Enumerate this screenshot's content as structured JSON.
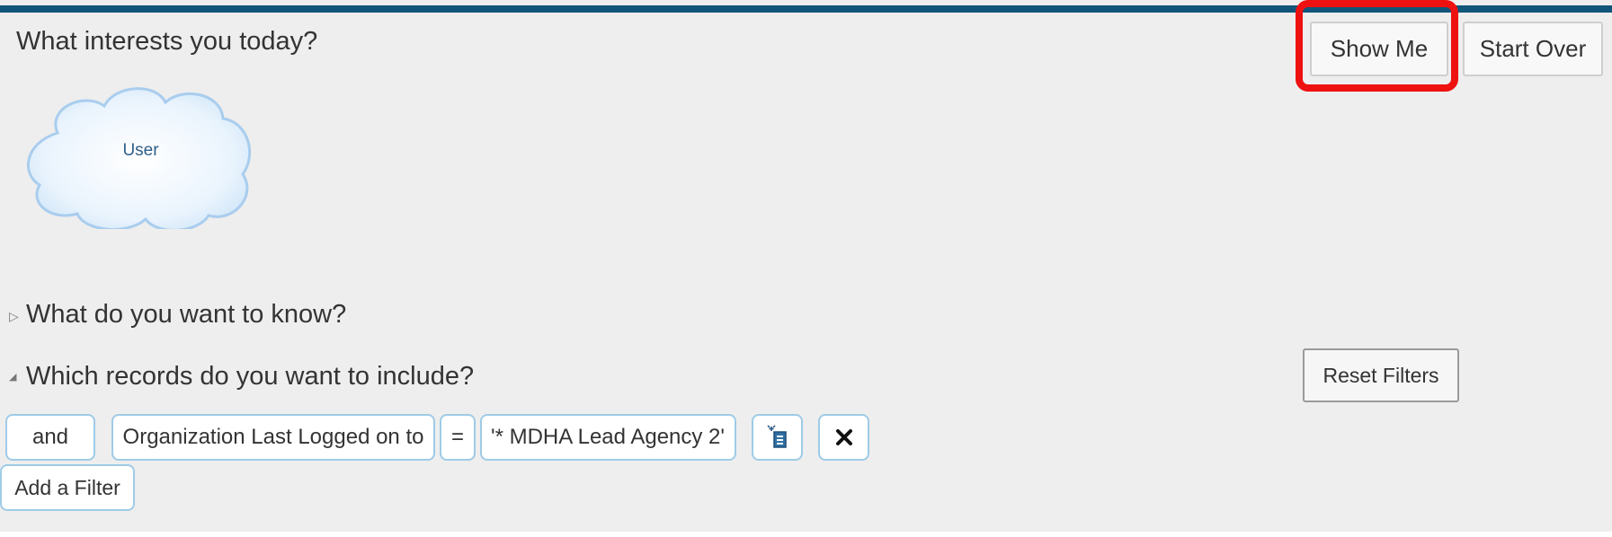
{
  "header": {
    "title": "What interests you today?",
    "show_me_label": "Show Me",
    "start_over_label": "Start Over"
  },
  "interests": [
    {
      "label": "User"
    }
  ],
  "sections": {
    "know_title": "What do you want to know?",
    "know_collapsed_glyph": "▷",
    "records_title": "Which records do you want to include?",
    "records_expanded_glyph": "◢",
    "reset_filters_label": "Reset Filters"
  },
  "filters": [
    {
      "conjunction": "and",
      "field": "Organization Last Logged on to",
      "operator": "=",
      "value": "'* MDHA Lead Agency 2'"
    }
  ],
  "add_filter_label": "Add a Filter",
  "colors": {
    "top_bar": "#11557a",
    "highlight": "#ee1111",
    "chip_border": "#9fcbe6",
    "cloud_text": "#2f5f8a"
  }
}
